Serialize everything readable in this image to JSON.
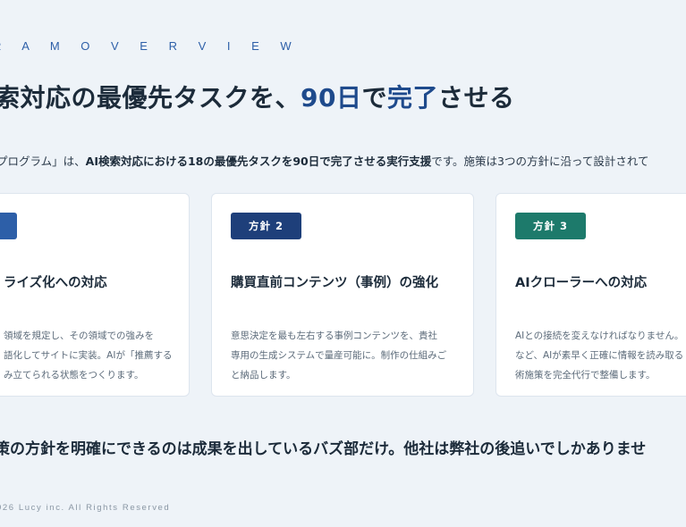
{
  "hero": {
    "eyebrow": "R A M   O V E R V I E W",
    "headline_pre": "索対応の最優先タスクを、",
    "headline_accent1": "90日",
    "headline_mid": "で",
    "headline_accent2": "完了",
    "headline_post": "させる",
    "lead_pre": "プログラム」は、",
    "lead_bold": "AI検索対応における18の最優先タスクを90日で完了させる実行支援",
    "lead_post": "です。施策は3つの方針に沿って設計されて"
  },
  "cards": [
    {
      "badge": "",
      "title": "ライズ化への対応",
      "body": [
        "領域を規定し、その領域での強みを",
        "語化してサイトに実装。AIが「推薦する",
        "み立てられる状態をつくります。"
      ]
    },
    {
      "badge": "方針 2",
      "title": "購買直前コンテンツ（事例）の強化",
      "body": [
        "意思決定を最も左右する事例コンテンツを、貴社",
        "専用の生成システムで量産可能に。制作の仕組みご",
        "と納品します。"
      ]
    },
    {
      "badge": "方針 3",
      "title": "AIクローラーへの対応",
      "body": [
        "AIとの接続を変えなければなりません。",
        "など、AIが素早く正確に情報を読み取る",
        "術施策を完全代行で整備します。"
      ]
    }
  ],
  "closing": "策の方針を明確にできるのは成果を出しているバズ部だけ。他社は弊社の後追いでしかありませ",
  "footer": "026 Lucy inc. All Rights Reserved",
  "colors": {
    "background": "#eef3f8",
    "accent_blue": "#1e4a8c",
    "badge_1": "#2d5fa8",
    "badge_2": "#1e3f7a",
    "badge_3": "#1d7a6b"
  }
}
